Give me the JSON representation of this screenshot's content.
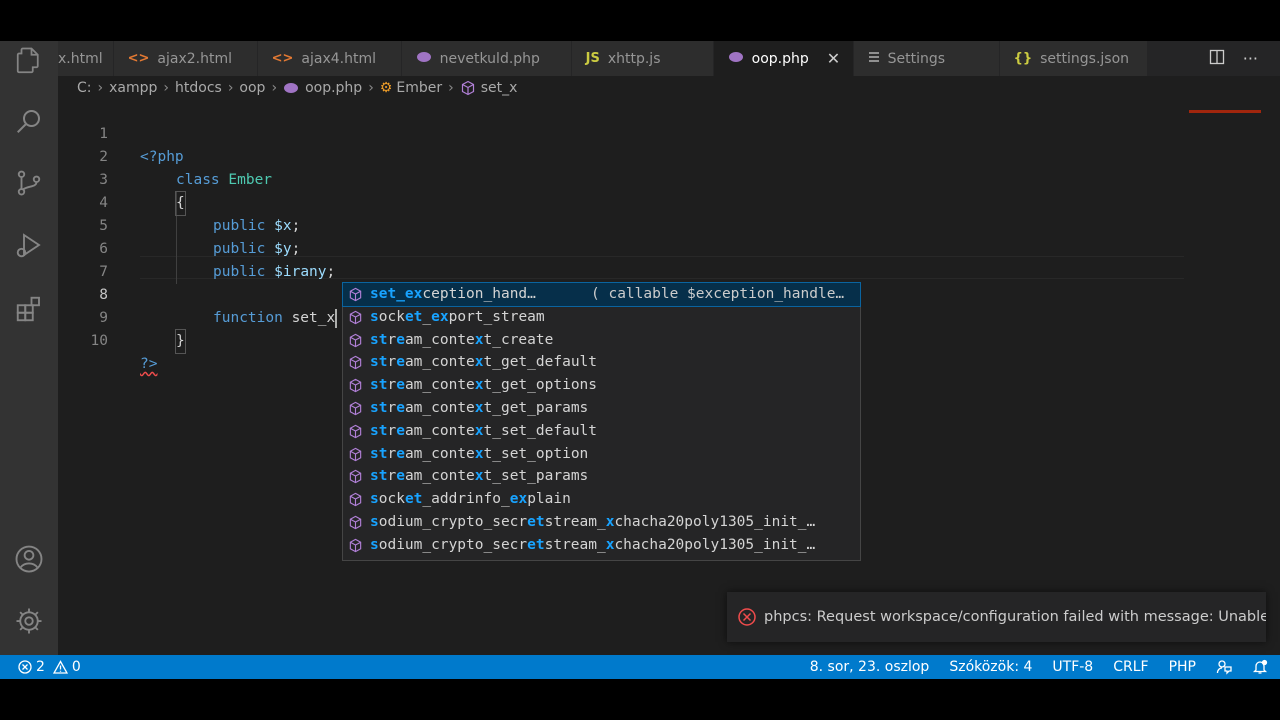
{
  "tabs": [
    {
      "label": "x.html",
      "icon": "",
      "active": false
    },
    {
      "label": "ajax2.html",
      "icon": "<>",
      "active": false
    },
    {
      "label": "ajax4.html",
      "icon": "<>",
      "active": false
    },
    {
      "label": "nevetkuld.php",
      "icon": "php-elephant-icon",
      "active": false
    },
    {
      "label": "xhttp.js",
      "icon": "JS",
      "active": false
    },
    {
      "label": "oop.php",
      "icon": "php-elephant-icon",
      "active": true
    },
    {
      "label": "Settings",
      "icon": "settings-lines-icon",
      "active": false
    },
    {
      "label": "settings.json",
      "icon": "{}",
      "active": false
    }
  ],
  "breadcrumb": {
    "items": [
      "C:",
      "xampp",
      "htdocs",
      "oop",
      "oop.php",
      "Ember",
      "set_x"
    ]
  },
  "editor": {
    "line_numbers": [
      "1",
      "2",
      "3",
      "4",
      "5",
      "6",
      "7",
      "8",
      "9",
      "10"
    ],
    "lines": {
      "l1_open": "<?php",
      "l2_kw": "class",
      "l2_name": "Ember",
      "l3": "{",
      "l4_kw": "public",
      "l4_var": "$x",
      "l5_kw": "public",
      "l5_var": "$y",
      "l6_kw": "public",
      "l6_var": "$irany",
      "l8_kw": "function",
      "l8_name": "set_x",
      "l9": "}",
      "l10": "?>"
    },
    "current_line": 8
  },
  "suggestions": {
    "selected_detail": "( callable $exception_handle…",
    "items": [
      {
        "parts": [
          [
            "set_e",
            true
          ],
          [
            "x",
            true
          ],
          [
            "ception_hand…",
            false
          ]
        ]
      },
      {
        "parts": [
          [
            "s",
            true
          ],
          [
            "ock",
            false
          ],
          [
            "et",
            true
          ],
          [
            "_",
            false
          ],
          [
            "e",
            true
          ],
          [
            "x",
            true
          ],
          [
            "port_stream",
            false
          ]
        ]
      },
      {
        "parts": [
          [
            "st",
            true
          ],
          [
            "r",
            false
          ],
          [
            "e",
            true
          ],
          [
            "am_conte",
            false
          ],
          [
            "x",
            true
          ],
          [
            "t_create",
            false
          ]
        ]
      },
      {
        "parts": [
          [
            "st",
            true
          ],
          [
            "r",
            false
          ],
          [
            "e",
            true
          ],
          [
            "am_conte",
            false
          ],
          [
            "x",
            true
          ],
          [
            "t_get_default",
            false
          ]
        ]
      },
      {
        "parts": [
          [
            "st",
            true
          ],
          [
            "r",
            false
          ],
          [
            "e",
            true
          ],
          [
            "am_conte",
            false
          ],
          [
            "x",
            true
          ],
          [
            "t_get_options",
            false
          ]
        ]
      },
      {
        "parts": [
          [
            "st",
            true
          ],
          [
            "r",
            false
          ],
          [
            "e",
            true
          ],
          [
            "am_conte",
            false
          ],
          [
            "x",
            true
          ],
          [
            "t_get_params",
            false
          ]
        ]
      },
      {
        "parts": [
          [
            "st",
            true
          ],
          [
            "r",
            false
          ],
          [
            "e",
            true
          ],
          [
            "am_conte",
            false
          ],
          [
            "x",
            true
          ],
          [
            "t_set_default",
            false
          ]
        ]
      },
      {
        "parts": [
          [
            "st",
            true
          ],
          [
            "r",
            false
          ],
          [
            "e",
            true
          ],
          [
            "am_conte",
            false
          ],
          [
            "x",
            true
          ],
          [
            "t_set_option",
            false
          ]
        ]
      },
      {
        "parts": [
          [
            "st",
            true
          ],
          [
            "r",
            false
          ],
          [
            "e",
            true
          ],
          [
            "am_conte",
            false
          ],
          [
            "x",
            true
          ],
          [
            "t_set_params",
            false
          ]
        ]
      },
      {
        "parts": [
          [
            "s",
            true
          ],
          [
            "ock",
            false
          ],
          [
            "et",
            true
          ],
          [
            "_addrinfo_",
            false
          ],
          [
            "e",
            true
          ],
          [
            "x",
            true
          ],
          [
            "plain",
            false
          ]
        ]
      },
      {
        "parts": [
          [
            "s",
            true
          ],
          [
            "odium_crypto_secr",
            false
          ],
          [
            "et",
            true
          ],
          [
            "stream_",
            false
          ],
          [
            "x",
            true
          ],
          [
            "chacha20poly1305_init_…",
            false
          ]
        ]
      },
      {
        "parts": [
          [
            "s",
            true
          ],
          [
            "odium_crypto_secr",
            false
          ],
          [
            "et",
            true
          ],
          [
            "stream_",
            false
          ],
          [
            "x",
            true
          ],
          [
            "chacha20poly1305_init_…",
            false
          ]
        ]
      }
    ]
  },
  "notification": {
    "message": "phpcs: Request workspace/configuration failed with message: Unable t…"
  },
  "statusbar": {
    "errors": "2",
    "warnings": "0",
    "position": "8. sor, 23. oszlop",
    "spaces": "Szóközök: 4",
    "encoding": "UTF-8",
    "eol": "CRLF",
    "language": "PHP"
  },
  "colors": {
    "statusbar": "#007acc",
    "editor_bg": "#1e1e1e",
    "activity_bar": "#333333",
    "keyword": "#569cd6",
    "class_name": "#4ec9b0",
    "variable": "#9cdcfe",
    "match_highlight": "#18a3ff",
    "error": "#f14c4c"
  }
}
